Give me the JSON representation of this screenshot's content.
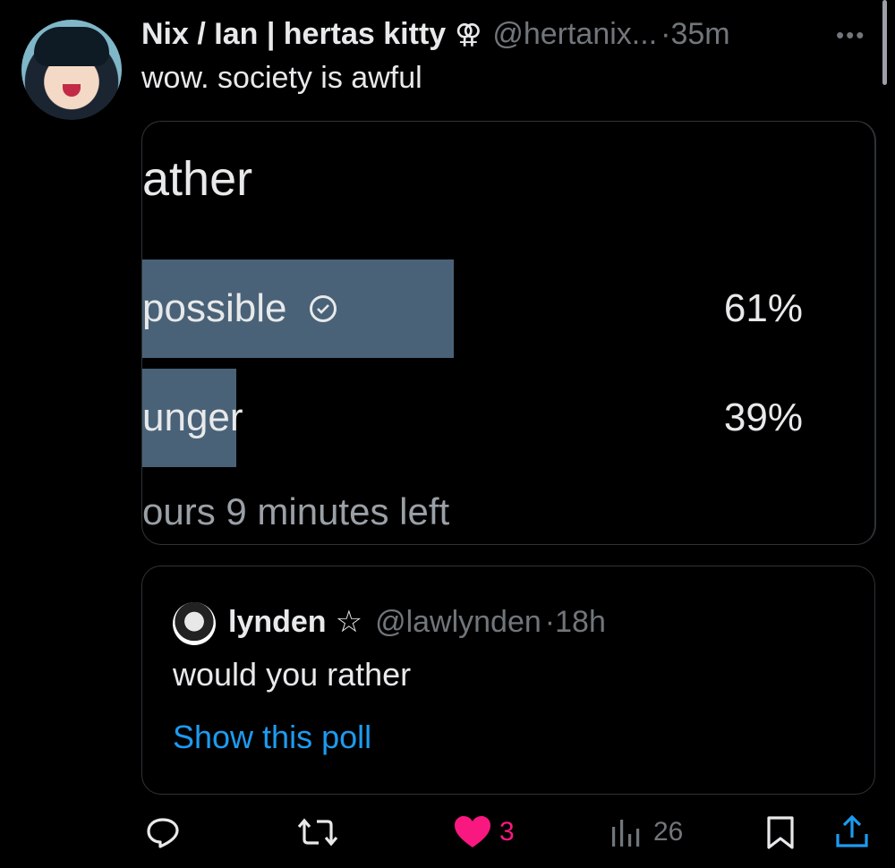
{
  "tweet": {
    "name": "Nix / Ian | hertas kitty",
    "name_symbol": "⚢",
    "handle": "@hertanix...",
    "time": "·35m",
    "more": "•••",
    "text": "wow. society is awful"
  },
  "poll": {
    "question": "ather",
    "options": [
      {
        "label": "possible",
        "percent_text": "61%",
        "value": 0.61,
        "winner": true
      },
      {
        "label": "unger",
        "percent_text": "39%",
        "value": 0.39,
        "winner": false
      }
    ],
    "footer": "ours 9 minutes left"
  },
  "quote": {
    "name": "lynden",
    "star": "☆",
    "handle": "@lawlynden",
    "time": "·18h",
    "text": "would you rather",
    "link": "Show this poll"
  },
  "actions": {
    "likes": "3",
    "views": "26"
  },
  "colors": {
    "background": "#000000",
    "poll_bar": "#4a6278",
    "link": "#1d9bf0",
    "like": "#f91880",
    "muted": "#71767b"
  }
}
